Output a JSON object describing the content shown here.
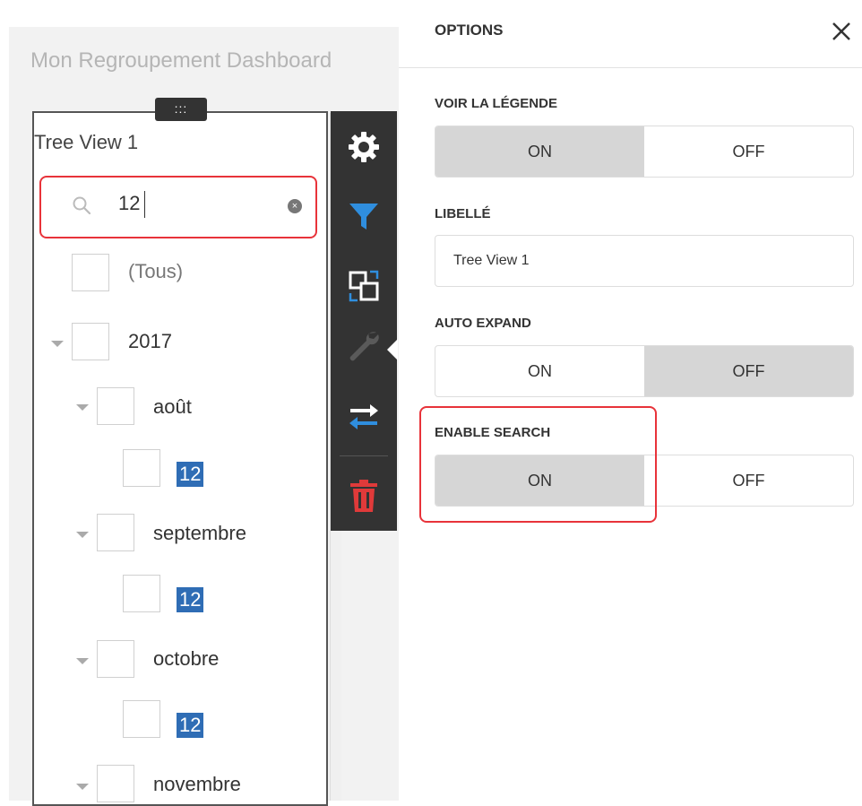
{
  "dashboard": {
    "title": "Mon Regroupement Dashboard",
    "handle_glyph": ":::",
    "item_caption": "Tree View 1"
  },
  "tree_view": {
    "search": {
      "value": "12",
      "clear_glyph": "×"
    },
    "items": [
      {
        "label": "(Tous)"
      },
      {
        "label": "2017"
      },
      {
        "label": "août"
      },
      {
        "label": "12"
      },
      {
        "label": "septembre"
      },
      {
        "label": "12"
      },
      {
        "label": "octobre"
      },
      {
        "label": "12"
      },
      {
        "label": "novembre"
      }
    ]
  },
  "toolbar": {
    "buttons": [
      {
        "name": "gear-icon"
      },
      {
        "name": "filter-icon",
        "color": "#2f8ede"
      },
      {
        "name": "convert-icon"
      },
      {
        "name": "wrench-icon",
        "active": true
      },
      {
        "name": "swap-icon"
      },
      {
        "name": "trash-icon",
        "color": "#e03a3a"
      }
    ]
  },
  "options_panel": {
    "title": "OPTIONS",
    "sections": {
      "show_legend": {
        "label": "VOIR LA LÉGENDE",
        "on": "ON",
        "off": "OFF",
        "selected": "ON"
      },
      "caption": {
        "label": "LIBELLÉ",
        "value": "Tree View 1"
      },
      "auto_expand": {
        "label": "AUTO EXPAND",
        "on": "ON",
        "off": "OFF",
        "selected": "OFF"
      },
      "enable_search": {
        "label": "ENABLE SEARCH",
        "on": "ON",
        "off": "OFF",
        "selected": "ON"
      }
    }
  },
  "colors": {
    "highlight": "#2f6db5",
    "annotation": "#e8333a",
    "toolbar_bg": "#333333",
    "selected_segment": "#d6d6d6"
  }
}
